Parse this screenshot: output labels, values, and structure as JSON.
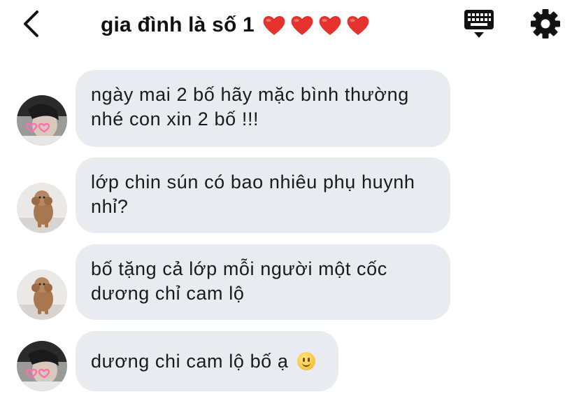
{
  "header": {
    "back_label": "",
    "title": "gia đình là số 1",
    "hearts": [
      "heart",
      "heart",
      "heart",
      "heart"
    ]
  },
  "icons": {
    "back": "chevron-left-icon",
    "keyboard": "keyboard-icon",
    "settings": "gear-icon"
  },
  "colors": {
    "bubble": "#e8ebf0",
    "heart": "#e5322d",
    "icon": "#111111"
  },
  "messages": [
    {
      "avatar": "avatar-child",
      "text": "ngày mai 2 bố hãy mặc bình thường nhé con xin 2 bố !!!"
    },
    {
      "avatar": "avatar-dog",
      "text": "lớp chin sún có bao nhiêu phụ huynh nhỉ?"
    },
    {
      "avatar": "avatar-dog",
      "text": "bố tặng cả lớp mỗi người một cốc dương chỉ cam lộ"
    },
    {
      "avatar": "avatar-child",
      "text": "dương chi cam lộ bố ạ",
      "emoji": "slightly-smiling-face"
    }
  ]
}
